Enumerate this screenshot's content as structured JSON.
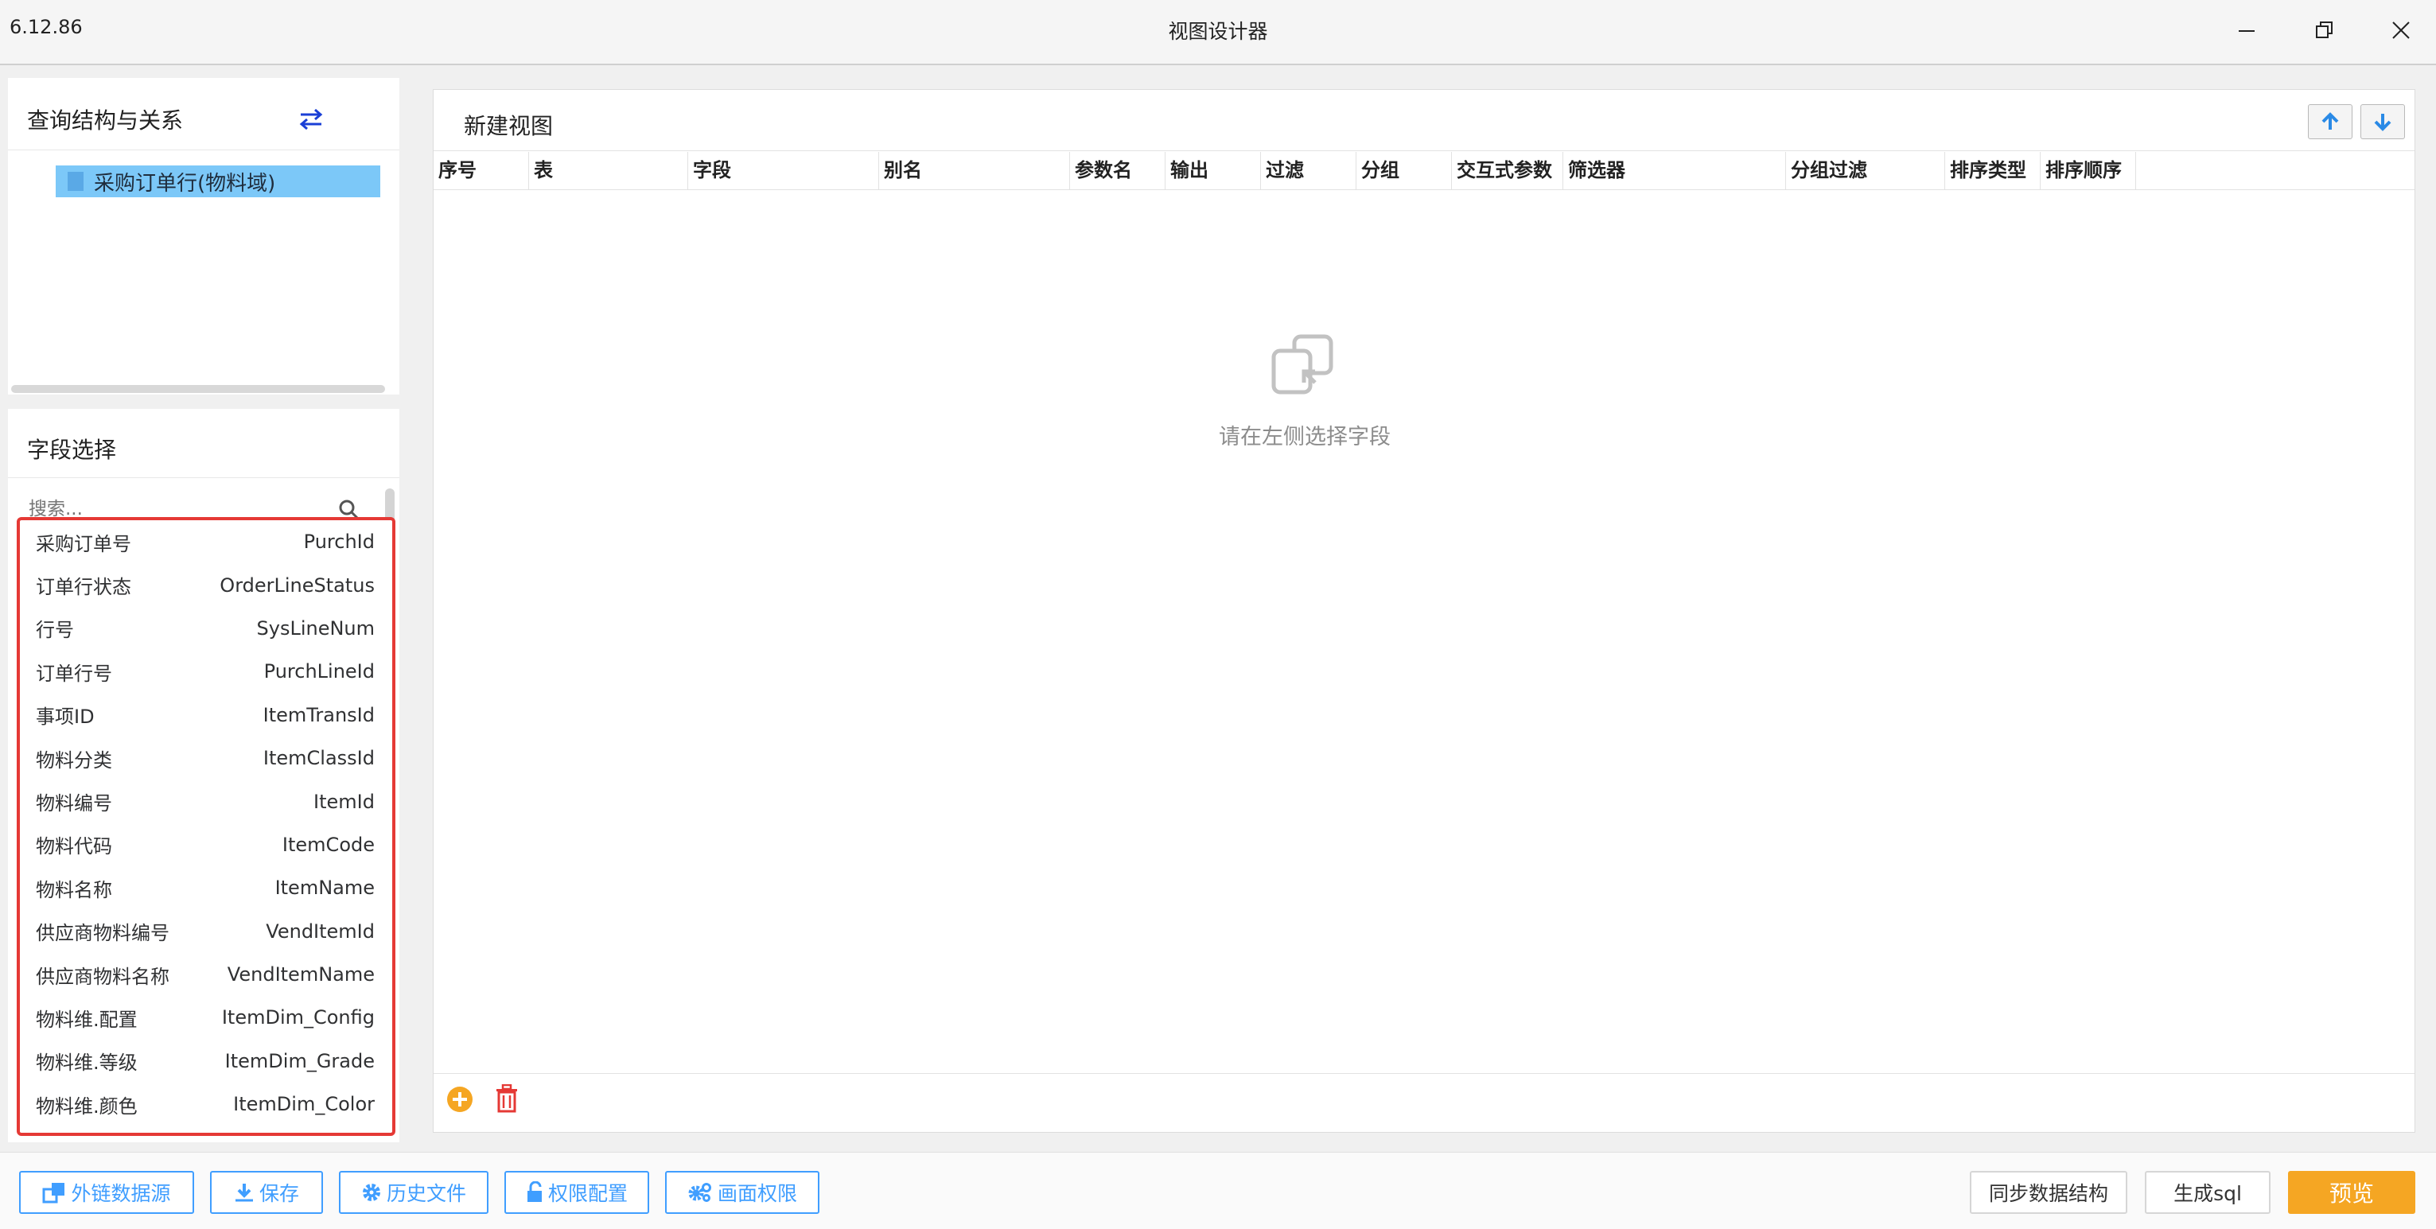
{
  "window": {
    "version": "6.12.86",
    "title": "视图设计器"
  },
  "left_top": {
    "title": "查询结构与关系",
    "tree_node": "采购订单行(物料域)"
  },
  "field_select": {
    "title": "字段选择",
    "search_placeholder": "搜索...",
    "fields": [
      {
        "label": "采购订单号",
        "code": "PurchId"
      },
      {
        "label": "订单行状态",
        "code": "OrderLineStatus"
      },
      {
        "label": "行号",
        "code": "SysLineNum"
      },
      {
        "label": "订单行号",
        "code": "PurchLineId"
      },
      {
        "label": "事项ID",
        "code": "ItemTransId"
      },
      {
        "label": "物料分类",
        "code": "ItemClassId"
      },
      {
        "label": "物料编号",
        "code": "ItemId"
      },
      {
        "label": "物料代码",
        "code": "ItemCode"
      },
      {
        "label": "物料名称",
        "code": "ItemName"
      },
      {
        "label": "供应商物料编号",
        "code": "VendItemId"
      },
      {
        "label": "供应商物料名称",
        "code": "VendItemName"
      },
      {
        "label": "物料维.配置",
        "code": "ItemDim_Config"
      },
      {
        "label": "物料维.等级",
        "code": "ItemDim_Grade"
      },
      {
        "label": "物料维.颜色",
        "code": "ItemDim_Color"
      }
    ]
  },
  "main": {
    "view_title": "新建视图",
    "columns": [
      "序号",
      "表",
      "字段",
      "别名",
      "参数名",
      "输出",
      "过滤",
      "分组",
      "交互式参数",
      "筛选器",
      "分组过滤",
      "排序类型",
      "排序顺序"
    ],
    "empty_text": "请在左侧选择字段"
  },
  "bottom": {
    "external_source": "外链数据源",
    "save": "保存",
    "history": "历史文件",
    "permission": "权限配置",
    "screen_permission": "画面权限",
    "sync": "同步数据结构",
    "gen_sql": "生成sql",
    "preview": "预览"
  },
  "colors": {
    "accent": "#409eff",
    "highlight": "#7cc8f8",
    "danger": "#e53935",
    "preview": "#f5a623"
  }
}
